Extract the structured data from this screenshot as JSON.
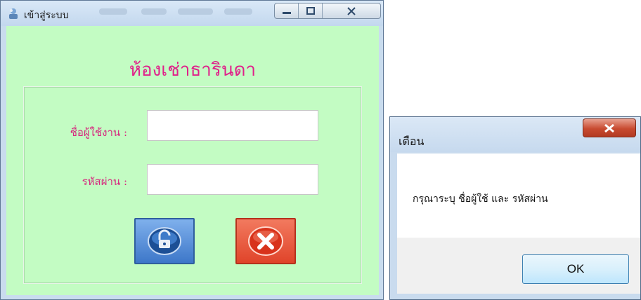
{
  "login_window": {
    "title": "เข้าสู่ระบบ",
    "heading": "ห้องเช่าธารินดา",
    "username_label": "ชื่อผู้ใช้งาน :",
    "username_value": "",
    "password_label": "รหัสผ่าน :",
    "password_value": "",
    "login_button_icon": "unlock-icon",
    "cancel_button_icon": "cancel-x-icon",
    "colors": {
      "background": "#c3fcc3",
      "label": "#d6287e",
      "heading": "#e0208a"
    }
  },
  "alert_dialog": {
    "title": "เตือน",
    "message": "กรุณาระบุ ชื่อผู้ใช้ และ รหัสผ่าน",
    "ok_label": "OK"
  }
}
